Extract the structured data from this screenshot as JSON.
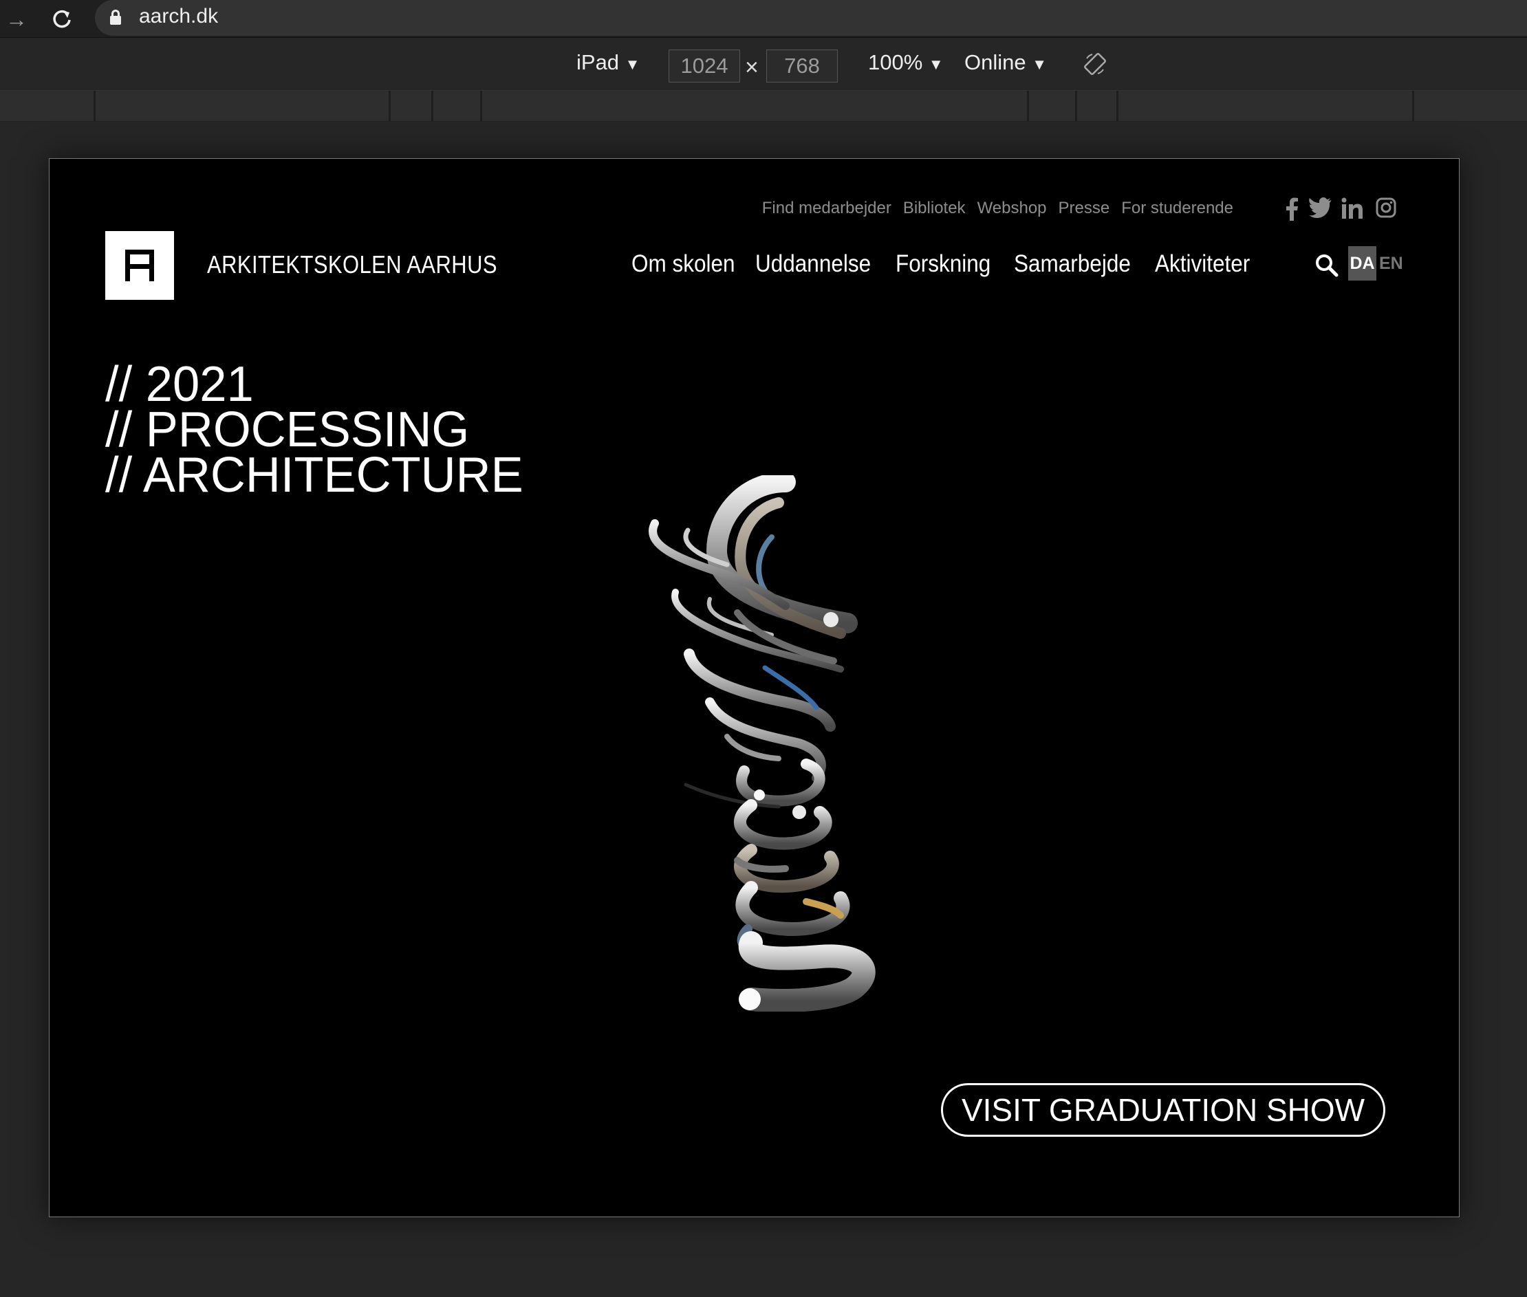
{
  "browser": {
    "url": "aarch.dk"
  },
  "devtools": {
    "device": "iPad",
    "width": "1024",
    "height": "768",
    "times": "×",
    "zoom": "100%",
    "throttle": "Online",
    "dropdown_arrow": "▼"
  },
  "site": {
    "utility_links": [
      "Find medarbejder",
      "Bibliotek",
      "Webshop",
      "Presse",
      "For studerende"
    ],
    "social_icons": [
      "facebook-icon",
      "twitter-icon",
      "linkedin-icon",
      "instagram-icon"
    ],
    "brand": "ARKITEKTSKOLEN AARHUS",
    "main_nav": [
      "Om skolen",
      "Uddannelse",
      "Forskning",
      "Samarbejde",
      "Aktiviteter"
    ],
    "lang": {
      "active": "DA",
      "other": "EN"
    },
    "hero": [
      "// 2021",
      "// PROCESSING",
      "// ARCHITECTURE"
    ],
    "cta": "VISIT GRADUATION SHOW"
  },
  "colors": {
    "page_bg": "#000000",
    "chrome_bg": "#262626",
    "muted_text": "#8d8d8d",
    "lang_active_bg": "#555555"
  }
}
